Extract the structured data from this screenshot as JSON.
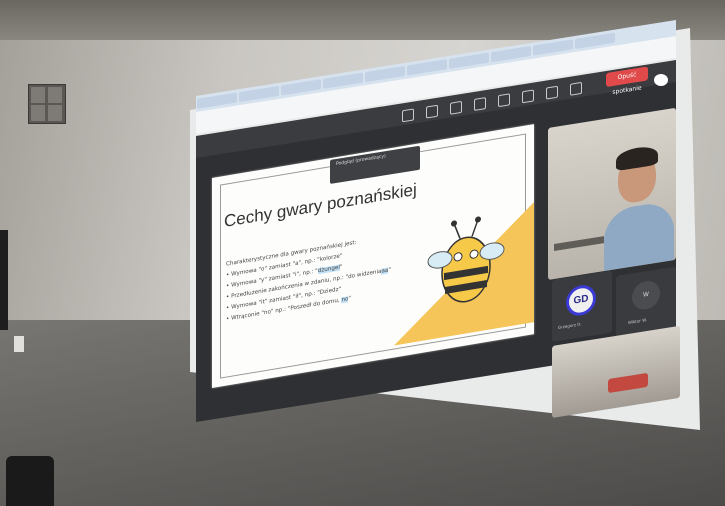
{
  "slide": {
    "title": "Cechy gwary poznańskiej",
    "intro": "Charakterystyczne dla gwary poznańskiej jest:",
    "bullets": [
      {
        "text": "• Wymowa \"o\" zamiast \"a\", np.: \"kolorze\"",
        "hl": ""
      },
      {
        "text": "• Wymowa \"y\" zamiast \"i\", np.: \"",
        "hl": "dżungel",
        "tail": "\""
      },
      {
        "text": "• Przedłużenie zakończenia w zdaniu, np.: \"do widzenia",
        "hl": "aa",
        "tail": "\""
      },
      {
        "text": "• Wymowa \"it\" zamiast \"ił\", np.: \"Dziedz\"",
        "hl": ""
      },
      {
        "text": "• Wtrąconie \"no\" np.: \"Poszedł do domu, ",
        "hl": "no",
        "tail": "\""
      }
    ]
  },
  "tooltip": {
    "line1": "Podgląd (prowadzący)"
  },
  "meeting": {
    "leave_label": "Opuść spotkanie"
  },
  "participants": [
    {
      "initials": "GD",
      "name": "Grzegorz D."
    },
    {
      "initials": "W",
      "name": "Wiktor W."
    }
  ]
}
